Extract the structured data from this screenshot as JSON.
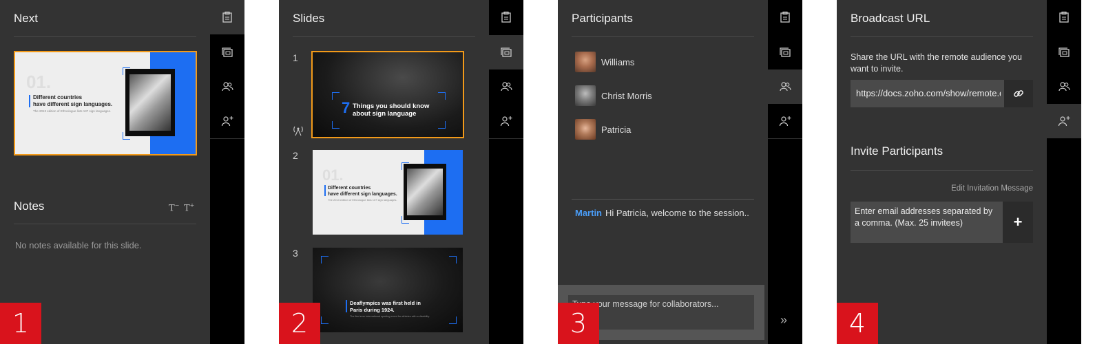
{
  "panels": [
    {
      "badge": "1",
      "title": "Next"
    },
    {
      "badge": "2",
      "title": "Slides"
    },
    {
      "badge": "3",
      "title": "Participants"
    },
    {
      "badge": "4",
      "title": "Broadcast URL"
    }
  ],
  "next": {
    "notes_title": "Notes",
    "font_decrease": "T",
    "font_increase": "T",
    "no_notes": "No notes available for this slide."
  },
  "slides": {
    "items": [
      {
        "number": "1",
        "title_line1": "Things you should know",
        "title_line2": "about sign language",
        "big_number": "7"
      },
      {
        "number": "2",
        "title_line1": "Different countries",
        "title_line2": "have different sign languages.",
        "subtitle": "The 2013 edition of Ethnologue lists 137 sign languages.",
        "ghost": "01."
      },
      {
        "number": "3",
        "title_line1": "Deaflympics was first held in",
        "title_line2": "Paris during 1924.",
        "subtitle": "The first ever international sporting event for athletes with a disability."
      }
    ]
  },
  "next_slide": {
    "title_line1": "Different countries",
    "title_line2": "have different sign languages.",
    "subtitle": "The 2013 edition of Ethnologue lists 137 sign languages.",
    "ghost": "01."
  },
  "participants": {
    "list": [
      {
        "name": "Williams"
      },
      {
        "name": "Christ Morris"
      },
      {
        "name": "Patricia"
      }
    ],
    "chat": {
      "sender": "Martin",
      "message": "Hi Patricia, welcome to the session.."
    },
    "input_placeholder": "Type your message for collaborators...",
    "collapse_glyph": "»"
  },
  "broadcast": {
    "description": "Share the URL with the remote audience you want to invite.",
    "url": "https://docs.zoho.com/show/remote.d",
    "invite_title": "Invite Participants",
    "edit_invitation": "Edit Invitation Message",
    "email_placeholder": "Enter email addresses separated by a comma. (Max. 25 invitees)",
    "add_glyph": "+"
  },
  "colors": {
    "panel_bg": "#333333",
    "rail_bg": "#000000",
    "badge": "#d9131c",
    "accent_blue": "#1d6ef2",
    "selection_orange": "#f39a19",
    "sender_blue": "#4a9df8"
  }
}
